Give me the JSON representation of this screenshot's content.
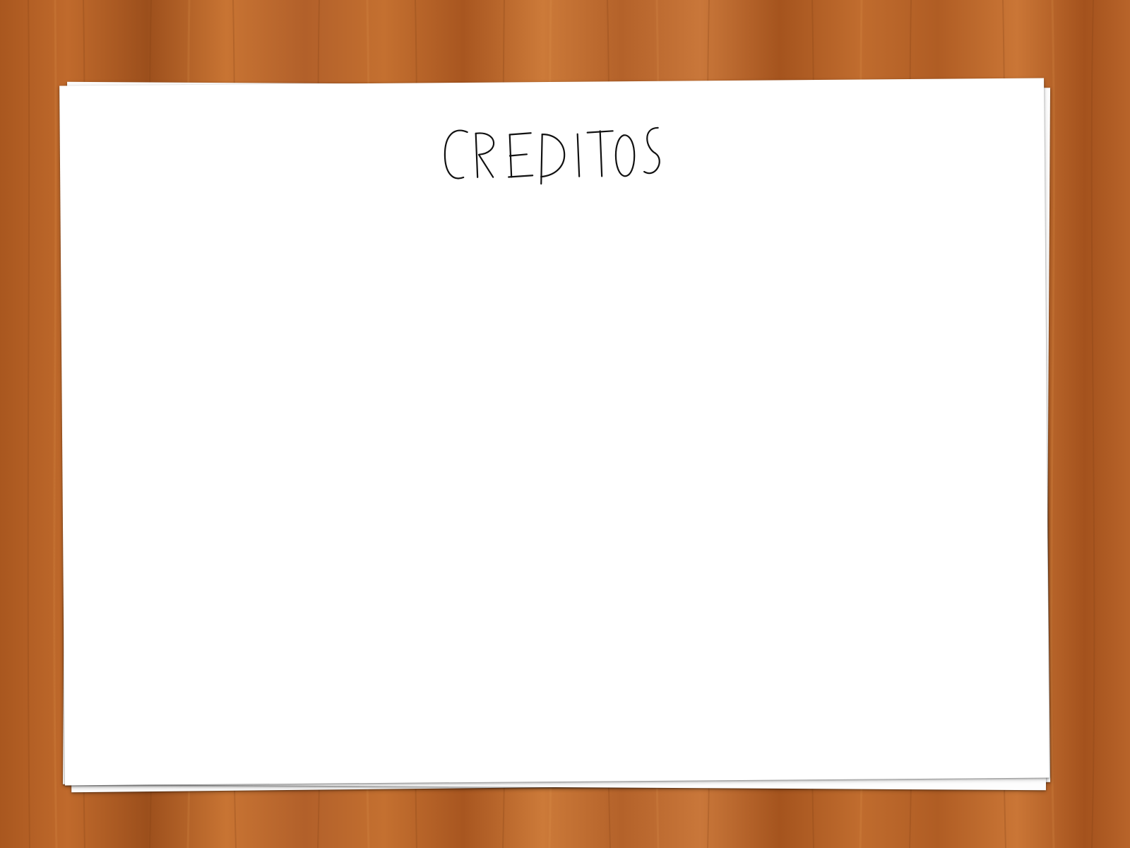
{
  "title": "CREDITOS",
  "colors": {
    "wood_base": "#b86528",
    "wood_dark": "#8e4a1c",
    "wood_light": "#d0813f",
    "paper": "#ffffff",
    "ink": "#111111"
  }
}
